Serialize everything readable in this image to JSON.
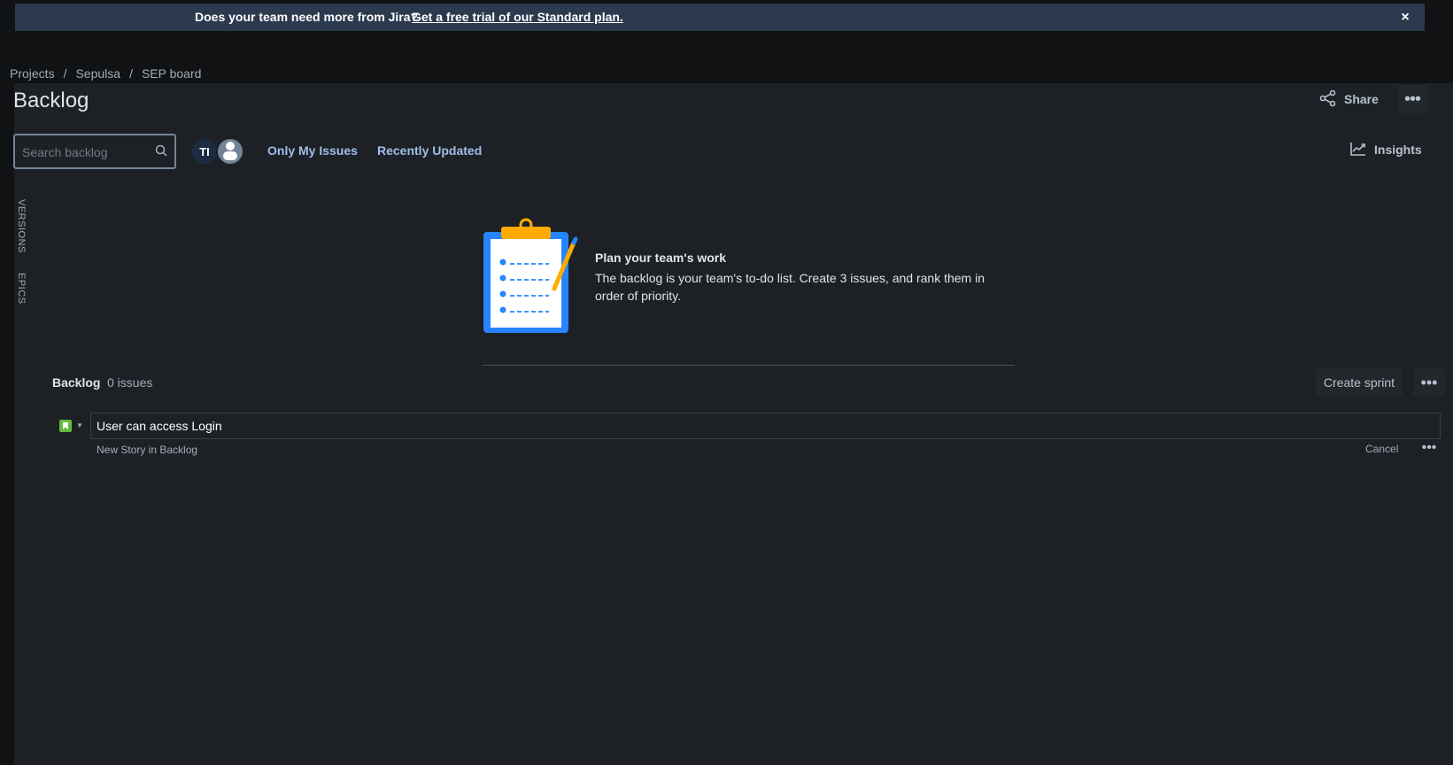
{
  "banner": {
    "message": "Does your team need more from Jira?",
    "link_text": "Get a free trial of our Standard plan.",
    "close_glyph": "×"
  },
  "breadcrumb": {
    "items": [
      "Projects",
      "Sepulsa",
      "SEP board"
    ],
    "separator": "/"
  },
  "page": {
    "title": "Backlog"
  },
  "header_actions": {
    "share_label": "Share",
    "more_glyph": "•••"
  },
  "filters": {
    "search_placeholder": "Search backlog",
    "avatar_initials": "TI",
    "only_my_issues": "Only My Issues",
    "recently_updated": "Recently Updated",
    "insights_label": "Insights"
  },
  "side_tabs": {
    "versions": "VERSIONS",
    "epics": "EPICS"
  },
  "empty_state": {
    "title": "Plan your team's work",
    "description": "The backlog is your team's to-do list. Create 3 issues, and rank them in order of priority."
  },
  "backlog": {
    "label": "Backlog",
    "count_text": "0 issues",
    "create_sprint_label": "Create sprint",
    "more_glyph": "•••"
  },
  "new_issue": {
    "value": "User can access Login",
    "hint": "New Story in Backlog",
    "cancel_label": "Cancel",
    "more_glyph": "•••",
    "type_icon": "story-icon",
    "type_color": "#63ba3c"
  },
  "colors": {
    "banner_bg": "#2c3a4f",
    "panel_bg": "#1d2125",
    "link_blue": "#9fbfe8"
  }
}
